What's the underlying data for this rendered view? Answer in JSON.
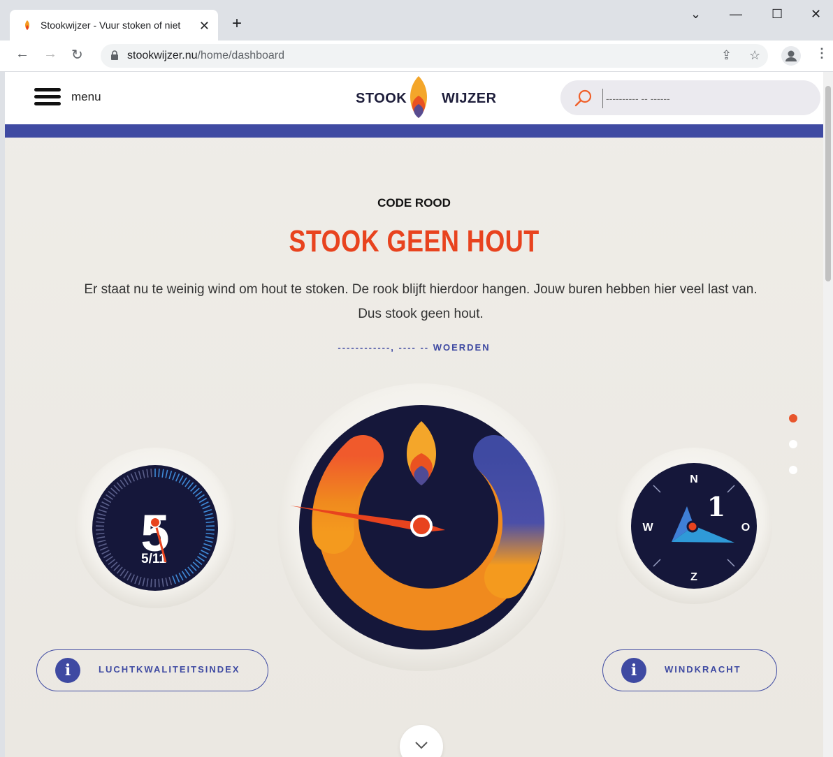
{
  "browser": {
    "tab_title": "Stookwijzer - Vuur stoken of niet",
    "url_host": "stookwijzer.nu",
    "url_path": "/home/dashboard"
  },
  "header": {
    "menu_label": "menu",
    "logo_left": "STOOK",
    "logo_right": "WIJZER",
    "search_placeholder": "---------- -- ------"
  },
  "status": {
    "code_label": "CODE ROOD",
    "headline": "STOOK GEEN HOUT",
    "description": "Er staat nu te weinig wind om hout te stoken. De rook blijft hierdoor hangen. Jouw buren hebben hier veel last van. Dus stook geen hout.",
    "location": "------------, ---- -- WOERDEN"
  },
  "air_quality": {
    "value": "5",
    "fraction": "5/11",
    "score": 5,
    "max": 11,
    "button_label": "LUCHTKWALITEITSINDEX"
  },
  "wind": {
    "force": "1",
    "compass": {
      "n": "N",
      "e": "O",
      "s": "Z",
      "w": "W"
    },
    "button_label": "WINDKRACHT"
  },
  "colors": {
    "brand_blue": "#3f4aa2",
    "alert_red": "#e8431e",
    "orange": "#f49a1e",
    "dial_dark": "#15173a"
  },
  "pagination": {
    "count": 3,
    "active": 0
  }
}
